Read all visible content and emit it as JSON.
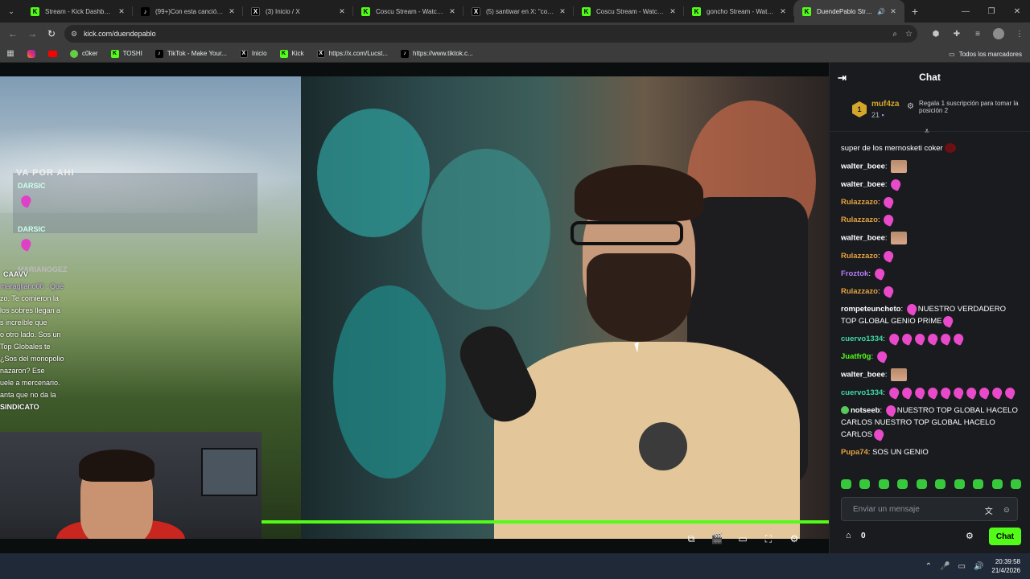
{
  "browser": {
    "tabs": [
      {
        "title": "Stream - Kick Dashboard",
        "favicon": "kick",
        "active": false
      },
      {
        "title": "(99+)Con esta canción m",
        "favicon": "tiktok",
        "active": false
      },
      {
        "title": "(3) Inicio / X",
        "favicon": "x",
        "active": false
      },
      {
        "title": "Coscu Stream - Watch Liv",
        "favicon": "kick",
        "active": false
      },
      {
        "title": "(5) santiwar en X: \"coscu e",
        "favicon": "x",
        "active": false
      },
      {
        "title": "Coscu Stream - Watch Liv",
        "favicon": "kick",
        "active": false
      },
      {
        "title": "goncho Stream - Watch L",
        "favicon": "kick",
        "active": false
      },
      {
        "title": "DuendePablo Stream",
        "favicon": "kick",
        "active": true
      }
    ],
    "url": "kick.com/duendepablo",
    "bookmarks": [
      {
        "label": "",
        "icon": "instagram"
      },
      {
        "label": "",
        "icon": "youtube"
      },
      {
        "label": "c0ker",
        "icon": "c0ker"
      },
      {
        "label": "TOSHI",
        "icon": "toshi"
      },
      {
        "label": "TikTok - Make Your...",
        "icon": "tiktok"
      },
      {
        "label": "Inicio",
        "icon": "x"
      },
      {
        "label": "Kick",
        "icon": "kick"
      },
      {
        "label": "https://x.com/Lucst...",
        "icon": "x"
      },
      {
        "label": "https://www.tiktok.c...",
        "icon": "tiktok"
      }
    ],
    "bookmarks_folder": "Todos los marcadores"
  },
  "overlay": {
    "title": "VA POR AHI",
    "names": [
      "DARSIC",
      "DARSIC",
      "MARIANOGEZ"
    ],
    "lines": [
      "CAAVV",
      "maragliano00 : Qué",
      "zo. Te comieron la",
      "los sobres llegan a",
      "s increíble que",
      "o otro lado. Sos un",
      "Top Globales te",
      "¿Sos del monopolio",
      "nazaron? Ese",
      "uele a mercenario.",
      "anta que no da la",
      "SINDICATO"
    ]
  },
  "chat": {
    "title": "Chat",
    "leaderboard": {
      "rank": "1",
      "name": "muf4za",
      "count": "21",
      "gift_text": "Regala 1 suscripción para tomar la posición 2"
    },
    "messages": [
      {
        "user": "",
        "color": "#ffffff",
        "text": "super de los mernosketi coker",
        "emotes": "red"
      },
      {
        "user": "walter_boee",
        "color": "#ffffff",
        "text": "",
        "emotes": "face"
      },
      {
        "user": "walter_boee",
        "color": "#ffffff",
        "text": "",
        "emotes": "pink1"
      },
      {
        "user": "Rulazzazo",
        "color": "#e8a33c",
        "text": "",
        "emotes": "pink1"
      },
      {
        "user": "Rulazzazo",
        "color": "#e8a33c",
        "text": "",
        "emotes": "pink1"
      },
      {
        "user": "walter_boee",
        "color": "#ffffff",
        "text": "",
        "emotes": "face"
      },
      {
        "user": "Rulazzazo",
        "color": "#e8a33c",
        "text": "",
        "emotes": "pink1"
      },
      {
        "user": "Froztok",
        "color": "#b57bf5",
        "text": "",
        "emotes": "pink1"
      },
      {
        "user": "Rulazzazo",
        "color": "#e8a33c",
        "text": "",
        "emotes": "pink1"
      },
      {
        "user": "rompeteuncheto",
        "color": "#ffffff",
        "text": "NUESTRO VERDADERO TOP GLOBAL GENIO PRIME",
        "emotes": "mixed"
      },
      {
        "user": "cuervo1334",
        "color": "#3fd9a5",
        "text": "",
        "emotes": "pink6"
      },
      {
        "user": "Juatfr0g",
        "color": "#53fc18",
        "text": "",
        "emotes": "pink1"
      },
      {
        "user": "walter_boee",
        "color": "#ffffff",
        "text": "",
        "emotes": "face"
      },
      {
        "user": "cuervo1334",
        "color": "#3fd9a5",
        "text": "",
        "emotes": "pink10"
      },
      {
        "user": "notseeb",
        "color": "#ffffff",
        "text": "NUESTRO TOP GLOBAL HACELO CARLOS NUESTRO TOP GLOBAL HACELO CARLOS",
        "emotes": "mixed2"
      },
      {
        "user": "Pupa74",
        "color": "#e8a33c",
        "text": "SOS UN GENIO",
        "emotes": ""
      }
    ],
    "input_placeholder": "Enviar un mensaje",
    "points": "0",
    "send_label": "Chat"
  },
  "taskbar": {
    "time": "20:39:58",
    "date": "21/4/2026"
  },
  "colors": {
    "kick_green": "#53fc18",
    "chat_bg": "#191b1f"
  }
}
